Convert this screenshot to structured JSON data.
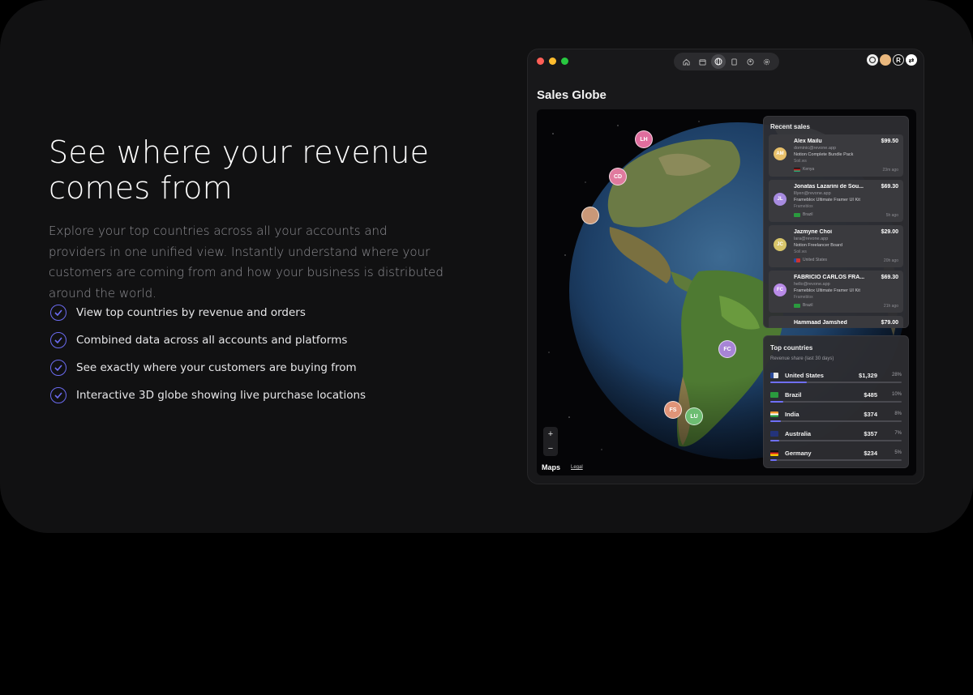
{
  "hero": {
    "headline": "See where your revenue comes from",
    "description": "Explore your top countries across all your accounts and providers in one unified view. Instantly understand where your customers are coming from and how your business is distributed around the world.",
    "features": [
      "View top countries by revenue and orders",
      "Combined data across all accounts and platforms",
      "See exactly where your customers are buying from",
      "Interactive 3D globe showing live purchase locations"
    ]
  },
  "app": {
    "title": "Sales Globe",
    "toolbar_icons": [
      "home-icon",
      "calendar-icon",
      "globe-icon",
      "document-icon",
      "user-icon",
      "settings-icon"
    ],
    "active_tool": "globe-icon",
    "map": {
      "zoom_in": "+",
      "zoom_out": "−",
      "provider": "Maps",
      "legal": "Legal"
    },
    "pins": [
      "LH",
      "CD",
      "FC",
      "FS",
      "LU"
    ],
    "recent_sales": {
      "title": "Recent sales",
      "items": [
        {
          "initials": "AM",
          "name": "Alex Mailu",
          "email": "dominic@revone.app",
          "product": "Notion Complete Bundle Pack",
          "source": "Soil.ws",
          "country": "Kenya",
          "amount": "$99.50",
          "time": "23m ago",
          "color": "#e8c06a"
        },
        {
          "initials": "JL",
          "name": "Jonatas Lazarini de Sou...",
          "email": "lllyen@revone.app",
          "product": "Frameblox Ultimate Framer UI Kit",
          "source": "Frameblox",
          "country": "Brazil",
          "amount": "$69.30",
          "time": "5h ago",
          "color": "#a78be0"
        },
        {
          "initials": "JC",
          "name": "Jazmyne Choi",
          "email": "lara@revone.app",
          "product": "Notion Freelancer Board",
          "source": "Soil.ws",
          "country": "United States",
          "amount": "$29.00",
          "time": "20h ago",
          "color": "#d8c56a"
        },
        {
          "initials": "FC",
          "name": "FABRICIO CARLOS FRA...",
          "email": "hello@revone.app",
          "product": "Frameblox Ultimate Framer UI Kit",
          "source": "Frameblox",
          "country": "Brazil",
          "amount": "$69.30",
          "time": "21h ago",
          "color": "#b98be8"
        },
        {
          "initials": "HJ",
          "name": "Hammaad Jamshed",
          "email": "",
          "product": "",
          "source": "",
          "country": "",
          "amount": "$79.00",
          "time": "",
          "color": "#888"
        }
      ]
    },
    "top_countries": {
      "title": "Top countries",
      "subtitle": "Revenue share (last 30 days)",
      "items": [
        {
          "name": "United States",
          "revenue": "$1,329",
          "share": "28%",
          "share_value": 28
        },
        {
          "name": "Brazil",
          "revenue": "$485",
          "share": "10%",
          "share_value": 10
        },
        {
          "name": "India",
          "revenue": "$374",
          "share": "8%",
          "share_value": 8
        },
        {
          "name": "Australia",
          "revenue": "$357",
          "share": "7%",
          "share_value": 7
        },
        {
          "name": "Germany",
          "revenue": "$234",
          "share": "5%",
          "share_value": 5
        }
      ]
    }
  },
  "colors": {
    "accent": "#6f6ff7",
    "check": "#6b6bf0",
    "card_bg": "#111112"
  }
}
